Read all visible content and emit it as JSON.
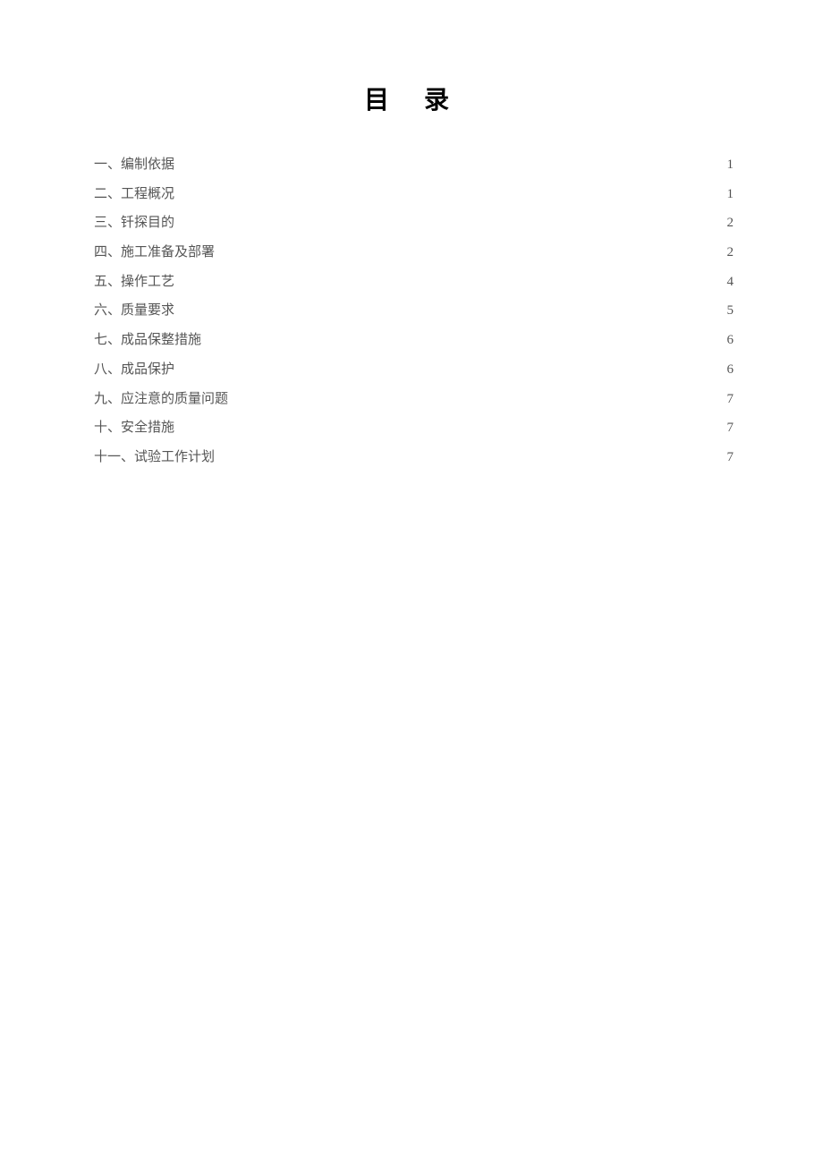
{
  "title": "目 录",
  "entries": [
    {
      "label": "一、编制依据",
      "page": "1"
    },
    {
      "label": "二、工程概况",
      "page": "1"
    },
    {
      "label": "三、钎探目的",
      "page": "2"
    },
    {
      "label": "四、施工准备及部署",
      "page": "2"
    },
    {
      "label": "五、操作工艺",
      "page": "4"
    },
    {
      "label": "六、质量要求",
      "page": "5"
    },
    {
      "label": "七、成品保整措施",
      "page": "6"
    },
    {
      "label": "八、成品保护",
      "page": "6"
    },
    {
      "label": "九、应注意的质量问题",
      "page": "7"
    },
    {
      "label": "十、安全措施",
      "page": "7"
    },
    {
      "label": "十一、试验工作计划",
      "page": "7"
    }
  ]
}
